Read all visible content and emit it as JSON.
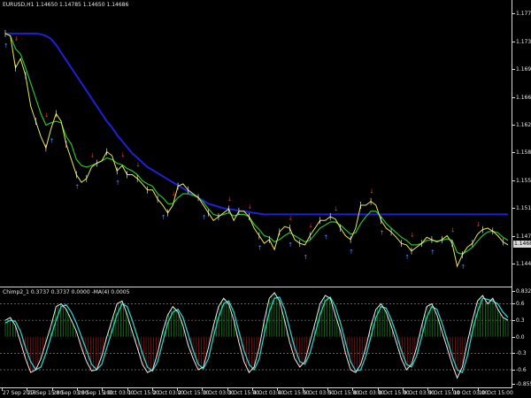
{
  "window": {
    "title": "EURUSD,H1  1.14650 1.14785 1.14650 1.14686"
  },
  "price_axis": {
    "labels": [
      "1.17715",
      "1.17350",
      "1.16985",
      "1.16620",
      "1.16255",
      "1.15890",
      "1.15525",
      "1.15160",
      "1.14795",
      "1.14430"
    ],
    "current": "1.14686"
  },
  "osc": {
    "title": "Chimp2_1 0.3737 0.3737 0.0000 -MA(4) 0.0005",
    "axis_labels": [
      "0.8324",
      "0.6",
      "0.3",
      "0.0",
      "-0.3",
      "-0.6",
      "-0.8555"
    ]
  },
  "time_axis": {
    "labels": [
      "27 Sep 2018",
      "27 Sep 15:00",
      "28 Sep 03:00",
      "28 Sep 15:00",
      "1 Oct 03:00",
      "1 Oct 15:00",
      "2 Oct 03:00",
      "2 Oct 15:00",
      "3 Oct 03:00",
      "3 Oct 15:00",
      "4 Oct 03:00",
      "4 Oct 15:00",
      "5 Oct 03:00",
      "5 Oct 15:00",
      "8 Oct 03:00",
      "8 Oct 15:00",
      "9 Oct 03:00",
      "9 Oct 15:00",
      "10 Oct 03:00",
      "10 Oct 15:00"
    ]
  },
  "colors": {
    "price": "#e8e85a",
    "slow_ma": "#1f1fd8",
    "fast_ma": "#2bc02b",
    "sell_arrow": "#e03030",
    "buy_arrow": "#3a8cff",
    "osc_main": "#e8e8e8",
    "osc_signal": "#2ad0c8",
    "hist_pos": "#1b8a1b",
    "hist_neg": "#8a1b1b"
  },
  "chart_data": [
    {
      "type": "line",
      "title": "EURUSD,H1",
      "ylim": [
        1.1425,
        1.1775
      ],
      "series": [
        {
          "name": "price",
          "values": [
            1.1745,
            1.1742,
            1.17,
            1.1712,
            1.169,
            1.165,
            1.163,
            1.161,
            1.1595,
            1.162,
            1.164,
            1.163,
            1.16,
            1.158,
            1.156,
            1.155,
            1.1555,
            1.157,
            1.1575,
            1.1578,
            1.159,
            1.1585,
            1.1565,
            1.1572,
            1.156,
            1.156,
            1.1555,
            1.1548,
            1.154,
            1.154,
            1.1528,
            1.152,
            1.151,
            1.152,
            1.1545,
            1.1548,
            1.154,
            1.1535,
            1.153,
            1.152,
            1.151,
            1.15,
            1.1505,
            1.151,
            1.1515,
            1.15,
            1.1512,
            1.1512,
            1.1505,
            1.149,
            1.148,
            1.147,
            1.1475,
            1.1462,
            1.1485,
            1.1492,
            1.149,
            1.1475,
            1.147,
            1.1468,
            1.148,
            1.149,
            1.15,
            1.15,
            1.1505,
            1.1502,
            1.149,
            1.148,
            1.1475,
            1.149,
            1.152,
            1.152,
            1.1525,
            1.152,
            1.15,
            1.149,
            1.1485,
            1.1478,
            1.147,
            1.1468,
            1.146,
            1.1465,
            1.147,
            1.1478,
            1.1475,
            1.1472,
            1.1475,
            1.148,
            1.147,
            1.144,
            1.1455,
            1.1465,
            1.147,
            1.1482,
            1.1488,
            1.149,
            1.1486,
            1.148,
            1.1472,
            1.1468
          ]
        },
        {
          "name": "fast_ma",
          "values": [
            1.1745,
            1.1742,
            1.1725,
            1.1718,
            1.17,
            1.168,
            1.166,
            1.164,
            1.1625,
            1.1628,
            1.163,
            1.1628,
            1.161,
            1.16,
            1.158,
            1.1572,
            1.157,
            1.1572,
            1.1575,
            1.1578,
            1.1582,
            1.158,
            1.1575,
            1.1573,
            1.1568,
            1.1565,
            1.156,
            1.1552,
            1.1548,
            1.1545,
            1.1535,
            1.153,
            1.1522,
            1.1522,
            1.153,
            1.1535,
            1.1535,
            1.1533,
            1.153,
            1.1524,
            1.1515,
            1.1508,
            1.1506,
            1.1508,
            1.151,
            1.1506,
            1.1508,
            1.1508,
            1.1505,
            1.1495,
            1.1488,
            1.148,
            1.1478,
            1.1472,
            1.1475,
            1.148,
            1.1484,
            1.148,
            1.1476,
            1.1472,
            1.1474,
            1.1482,
            1.149,
            1.1494,
            1.1498,
            1.1498,
            1.1494,
            1.1488,
            1.1482,
            1.1484,
            1.1496,
            1.1505,
            1.1512,
            1.1512,
            1.1505,
            1.1496,
            1.149,
            1.1484,
            1.1478,
            1.1474,
            1.1468,
            1.1468,
            1.147,
            1.1474,
            1.1474,
            1.1473,
            1.1474,
            1.1476,
            1.1474,
            1.1458,
            1.1456,
            1.146,
            1.1465,
            1.1473,
            1.148,
            1.1485,
            1.1486,
            1.1484,
            1.1478,
            1.1474
          ]
        },
        {
          "name": "slow_ma",
          "values": [
            1.1745,
            1.1745,
            1.1745,
            1.1745,
            1.1745,
            1.1745,
            1.1745,
            1.1744,
            1.1742,
            1.1738,
            1.173,
            1.172,
            1.171,
            1.17,
            1.169,
            1.168,
            1.167,
            1.166,
            1.165,
            1.164,
            1.163,
            1.1622,
            1.1612,
            1.1604,
            1.1596,
            1.1588,
            1.1582,
            1.1576,
            1.157,
            1.1566,
            1.1562,
            1.1558,
            1.1554,
            1.155,
            1.1546,
            1.1542,
            1.1538,
            1.1534,
            1.153,
            1.1526,
            1.1522,
            1.152,
            1.1518,
            1.1516,
            1.1515,
            1.1514,
            1.1513,
            1.1512,
            1.1511,
            1.151,
            1.1509,
            1.1508,
            1.1508,
            1.1508,
            1.1508,
            1.1508,
            1.1508,
            1.1508,
            1.1508,
            1.1508,
            1.1508,
            1.1508,
            1.1508,
            1.1508,
            1.1508,
            1.1508,
            1.1508,
            1.1508,
            1.1508,
            1.1508,
            1.1508,
            1.1508,
            1.1508,
            1.1508,
            1.1508,
            1.1508,
            1.1508,
            1.1508,
            1.1508,
            1.1508,
            1.1508,
            1.1508,
            1.1508,
            1.1508,
            1.1508,
            1.1508,
            1.1508,
            1.1508,
            1.1508,
            1.1508,
            1.1508,
            1.1508,
            1.1508,
            1.1508,
            1.1508,
            1.1508,
            1.1508,
            1.1508,
            1.1508,
            1.1508
          ]
        }
      ],
      "sell_signals": [
        2,
        8,
        17,
        23,
        26,
        33,
        44,
        48,
        56,
        60,
        65,
        72,
        80,
        88,
        93
      ],
      "buy_signals": [
        0,
        9,
        14,
        22,
        31,
        39,
        50,
        56,
        59,
        63,
        68,
        74,
        79,
        84,
        90
      ]
    },
    {
      "type": "line",
      "title": "Chimp2_1",
      "ylim": [
        -0.8555,
        0.8324
      ],
      "series": [
        {
          "name": "main",
          "values": [
            0.3,
            0.35,
            0.2,
            -0.1,
            -0.4,
            -0.65,
            -0.6,
            -0.4,
            -0.1,
            0.2,
            0.55,
            0.6,
            0.5,
            0.3,
            0.1,
            -0.2,
            -0.45,
            -0.62,
            -0.6,
            -0.35,
            0.0,
            0.3,
            0.6,
            0.65,
            0.4,
            0.1,
            -0.2,
            -0.5,
            -0.65,
            -0.6,
            -0.3,
            0.1,
            0.4,
            0.55,
            0.45,
            0.2,
            -0.15,
            -0.4,
            -0.6,
            -0.55,
            -0.2,
            0.2,
            0.55,
            0.7,
            0.6,
            0.3,
            -0.1,
            -0.45,
            -0.65,
            -0.55,
            -0.2,
            0.3,
            0.7,
            0.8,
            0.65,
            0.3,
            -0.1,
            -0.4,
            -0.55,
            -0.45,
            -0.1,
            0.25,
            0.6,
            0.75,
            0.7,
            0.4,
            0.1,
            -0.3,
            -0.6,
            -0.65,
            -0.5,
            -0.2,
            0.2,
            0.5,
            0.6,
            0.45,
            0.2,
            -0.1,
            -0.4,
            -0.6,
            -0.5,
            -0.2,
            0.2,
            0.55,
            0.6,
            0.4,
            0.1,
            -0.2,
            -0.5,
            -0.75,
            -0.55,
            -0.1,
            0.3,
            0.65,
            0.75,
            0.6,
            0.7,
            0.5,
            0.35,
            0.3
          ]
        },
        {
          "name": "signal",
          "values": [
            0.25,
            0.3,
            0.28,
            0.1,
            -0.2,
            -0.45,
            -0.6,
            -0.55,
            -0.3,
            0.0,
            0.3,
            0.55,
            0.58,
            0.45,
            0.25,
            0.0,
            -0.25,
            -0.5,
            -0.6,
            -0.5,
            -0.2,
            0.1,
            0.4,
            0.6,
            0.55,
            0.3,
            0.0,
            -0.3,
            -0.55,
            -0.62,
            -0.45,
            -0.1,
            0.25,
            0.45,
            0.5,
            0.35,
            0.05,
            -0.25,
            -0.5,
            -0.58,
            -0.4,
            0.0,
            0.35,
            0.6,
            0.65,
            0.45,
            0.1,
            -0.25,
            -0.5,
            -0.6,
            -0.4,
            0.05,
            0.45,
            0.7,
            0.72,
            0.5,
            0.15,
            -0.2,
            -0.45,
            -0.5,
            -0.3,
            0.05,
            0.4,
            0.65,
            0.72,
            0.55,
            0.25,
            -0.1,
            -0.45,
            -0.62,
            -0.6,
            -0.35,
            0.0,
            0.35,
            0.55,
            0.52,
            0.32,
            0.05,
            -0.25,
            -0.5,
            -0.55,
            -0.35,
            0.0,
            0.35,
            0.55,
            0.5,
            0.25,
            -0.05,
            -0.35,
            -0.6,
            -0.65,
            -0.35,
            0.1,
            0.45,
            0.7,
            0.68,
            0.65,
            0.6,
            0.45,
            0.35
          ]
        }
      ],
      "levels": [
        0.6,
        0.3,
        -0.3,
        -0.6
      ]
    }
  ]
}
